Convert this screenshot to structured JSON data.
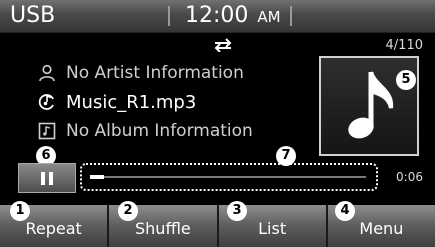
{
  "status_bar": {
    "source": "USB",
    "time": "12:00",
    "ampm": "AM"
  },
  "playback": {
    "repeat_icon": "repeat-icon",
    "track_counter": "4/110",
    "elapsed": "0:06",
    "progress_fraction": 0.05
  },
  "track": {
    "artist": "No Artist Information",
    "title": "Music_R1.mp3",
    "album": "No Album Information",
    "artist_icon": "person-icon",
    "title_icon": "music-file-icon",
    "album_icon": "album-icon",
    "album_art_icon": "music-note-icon"
  },
  "callouts": {
    "pause": "6",
    "progress": "7",
    "album_art": "5",
    "repeat": "1",
    "shuffle": "2",
    "list": "3",
    "menu": "4"
  },
  "menu": {
    "repeat": "Repeat",
    "shuffle": "Shuffle",
    "list": "List",
    "menu": "Menu"
  }
}
